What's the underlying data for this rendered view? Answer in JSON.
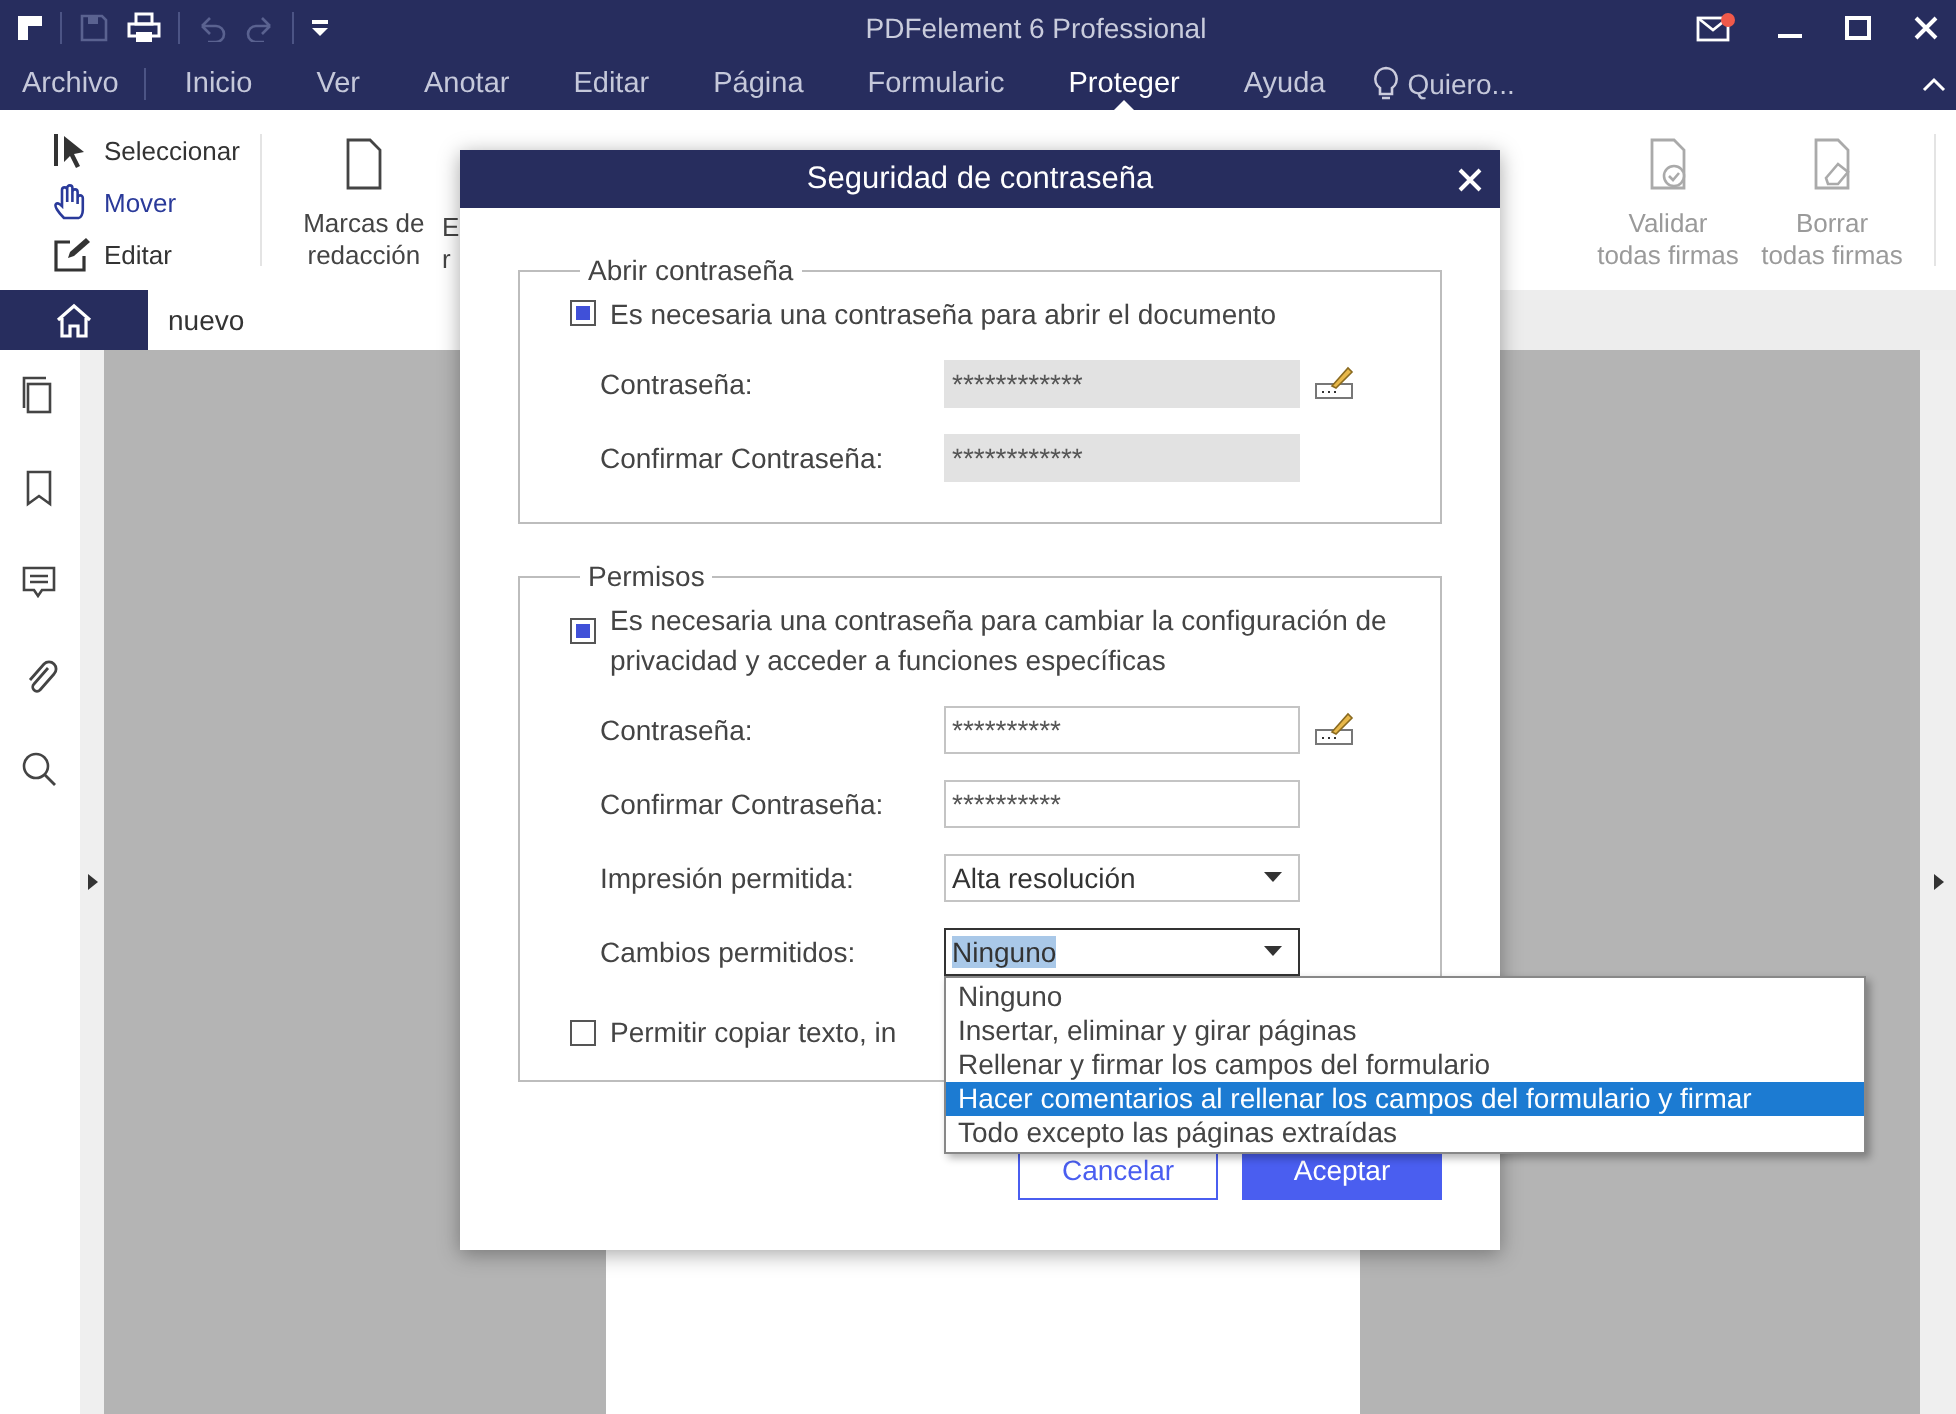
{
  "window": {
    "title": "PDFelement 6 Professional",
    "notification": true
  },
  "menu": [
    {
      "label": "Archivo",
      "selected": false
    },
    {
      "label": "Inicio",
      "selected": false
    },
    {
      "label": "Ver",
      "selected": false
    },
    {
      "label": "Anotar",
      "selected": false
    },
    {
      "label": "Editar",
      "selected": false
    },
    {
      "label": "Página",
      "selected": false
    },
    {
      "label": "Formularic",
      "selected": false
    },
    {
      "label": "Proteger",
      "selected": true
    },
    {
      "label": "Ayuda",
      "selected": false
    }
  ],
  "menu_search": "Quiero...",
  "ribbon": {
    "modes": [
      {
        "label": "Seleccionar",
        "selected": false
      },
      {
        "label": "Mover",
        "selected": true
      },
      {
        "label": "Editar",
        "selected": false
      }
    ],
    "left_tools": [
      {
        "lines": [
          "Marcas de",
          "redacción"
        ],
        "disabled": false
      },
      {
        "lines": [
          "E",
          "r"
        ]
      }
    ],
    "right_tools": [
      {
        "lines": [
          "Validar",
          "todas firmas"
        ],
        "disabled": true
      },
      {
        "lines": [
          "Borrar",
          "todas firmas"
        ],
        "disabled": true
      }
    ]
  },
  "document_tabs": [
    {
      "label": "nuevo",
      "selected": true
    }
  ],
  "dialog": {
    "title": "Seguridad de contraseña",
    "groups": [
      {
        "legend": "Abrir contraseña",
        "checkbox": {
          "label": "Es necesaria una contraseña para abrir el documento",
          "checked": true
        },
        "rows": [
          {
            "kind": "password",
            "label": "Contraseña:",
            "value": "************",
            "disabled": true,
            "edit_icon": true
          },
          {
            "kind": "password",
            "label": "Confirmar Contraseña:",
            "value": "************",
            "disabled": true,
            "edit_icon": false
          }
        ]
      },
      {
        "legend": "Permisos",
        "checkbox": {
          "label": "Es necesaria una contraseña para cambiar la configuración de privacidad y acceder a funciones específicas",
          "checked": true
        },
        "rows": [
          {
            "kind": "password",
            "label": "Contraseña:",
            "value": "**********",
            "disabled": false,
            "edit_icon": true
          },
          {
            "kind": "password",
            "label": "Confirmar Contraseña:",
            "value": "**********",
            "disabled": false,
            "edit_icon": false
          },
          {
            "kind": "select",
            "label": "Impresión permitida:",
            "value": "Alta resolución",
            "open": false
          },
          {
            "kind": "select",
            "label": "Cambios permitidos:",
            "value": "Ninguno",
            "open": true,
            "options": [
              {
                "label": "Ninguno",
                "highlighted": false
              },
              {
                "label": "Insertar, eliminar y girar páginas",
                "highlighted": false
              },
              {
                "label": "Rellenar y firmar los campos del formulario",
                "highlighted": false
              },
              {
                "label": "Hacer comentarios al rellenar los campos del formulario y firmar",
                "highlighted": true
              },
              {
                "label": "Todo excepto las páginas extraídas",
                "highlighted": false
              }
            ]
          }
        ],
        "extra_checkbox": {
          "label": "Permitir copiar texto, in",
          "checked": false
        }
      }
    ],
    "buttons": [
      {
        "label": "Cancelar",
        "kind": "secondary"
      },
      {
        "label": "Aceptar",
        "kind": "primary"
      }
    ]
  }
}
